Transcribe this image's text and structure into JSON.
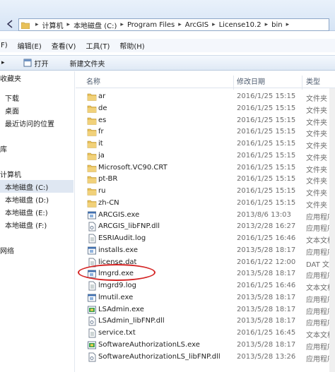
{
  "address": {
    "crumbs": [
      "计算机",
      "本地磁盘 (C:)",
      "Program Files",
      "ArcGIS",
      "License10.2",
      "bin"
    ]
  },
  "menu": [
    "F)",
    "编辑(E)",
    "查看(V)",
    "工具(T)",
    "帮助(H)"
  ],
  "toolbar": {
    "open_label": "打开",
    "new_folder_label": "新建文件夹"
  },
  "nav": [
    {
      "label": "收藏夹",
      "sel": false
    },
    {
      "label": "下载",
      "sel": false
    },
    {
      "label": "桌面",
      "sel": false
    },
    {
      "label": "最近访问的位置",
      "sel": false
    },
    {
      "label": "库",
      "sel": false
    },
    {
      "label": "计算机",
      "sel": false
    },
    {
      "label": "本地磁盘 (C:)",
      "sel": true
    },
    {
      "label": "本地磁盘 (D:)",
      "sel": false
    },
    {
      "label": "本地磁盘 (E:)",
      "sel": false
    },
    {
      "label": "本地磁盘 (F:)",
      "sel": false
    },
    {
      "label": "网络",
      "sel": false
    }
  ],
  "columns": {
    "name": "名称",
    "date": "修改日期",
    "type": "类型"
  },
  "files": [
    {
      "name": "ar",
      "date": "2016/1/25 15:15",
      "type": "文件夹",
      "icon": "folder-icon"
    },
    {
      "name": "de",
      "date": "2016/1/25 15:15",
      "type": "文件夹",
      "icon": "folder-icon"
    },
    {
      "name": "es",
      "date": "2016/1/25 15:15",
      "type": "文件夹",
      "icon": "folder-icon"
    },
    {
      "name": "fr",
      "date": "2016/1/25 15:15",
      "type": "文件夹",
      "icon": "folder-icon"
    },
    {
      "name": "it",
      "date": "2016/1/25 15:15",
      "type": "文件夹",
      "icon": "folder-icon"
    },
    {
      "name": "ja",
      "date": "2016/1/25 15:15",
      "type": "文件夹",
      "icon": "folder-icon"
    },
    {
      "name": "Microsoft.VC90.CRT",
      "date": "2016/1/25 15:15",
      "type": "文件夹",
      "icon": "folder-icon"
    },
    {
      "name": "pt-BR",
      "date": "2016/1/25 15:15",
      "type": "文件夹",
      "icon": "folder-icon"
    },
    {
      "name": "ru",
      "date": "2016/1/25 15:15",
      "type": "文件夹",
      "icon": "folder-icon"
    },
    {
      "name": "zh-CN",
      "date": "2016/1/25 15:15",
      "type": "文件夹",
      "icon": "folder-icon"
    },
    {
      "name": "ARCGIS.exe",
      "date": "2013/8/6 13:03",
      "type": "应用程序",
      "icon": "exe-icon"
    },
    {
      "name": "ARCGIS_libFNP.dll",
      "date": "2013/2/28 16:27",
      "type": "应用程序",
      "icon": "dll-icon"
    },
    {
      "name": "ESRIAudit.log",
      "date": "2016/1/25 16:46",
      "type": "文本文档",
      "icon": "text-file-icon"
    },
    {
      "name": "installs.exe",
      "date": "2013/5/28 18:17",
      "type": "应用程序",
      "icon": "exe-icon"
    },
    {
      "name": "license.dat",
      "date": "2016/1/22 12:00",
      "type": "DAT 文件",
      "icon": "text-file-icon"
    },
    {
      "name": "lmgrd.exe",
      "date": "2013/5/28 18:17",
      "type": "应用程序",
      "icon": "exe-icon"
    },
    {
      "name": "lmgrd9.log",
      "date": "2016/1/25 16:46",
      "type": "文本文档",
      "icon": "text-file-icon"
    },
    {
      "name": "lmutil.exe",
      "date": "2013/5/28 18:17",
      "type": "应用程序",
      "icon": "exe-icon"
    },
    {
      "name": "LSAdmin.exe",
      "date": "2013/5/28 18:17",
      "type": "应用程序",
      "icon": "app-icon"
    },
    {
      "name": "LSAdmin_libFNP.dll",
      "date": "2013/5/28 18:17",
      "type": "应用程序",
      "icon": "dll-icon"
    },
    {
      "name": "service.txt",
      "date": "2016/1/25 16:45",
      "type": "文本文档",
      "icon": "text-file-icon"
    },
    {
      "name": "SoftwareAuthorizationLS.exe",
      "date": "2013/5/28 18:17",
      "type": "应用程序",
      "icon": "app-icon"
    },
    {
      "name": "SoftwareAuthorizationLS_libFNP.dll",
      "date": "2013/5/28 13:26",
      "type": "应用程序",
      "icon": "dll-icon"
    }
  ],
  "colors": {
    "folder": "#e8c15a",
    "highlight": "#d42424",
    "selected_nav": "#dfe7f2"
  }
}
